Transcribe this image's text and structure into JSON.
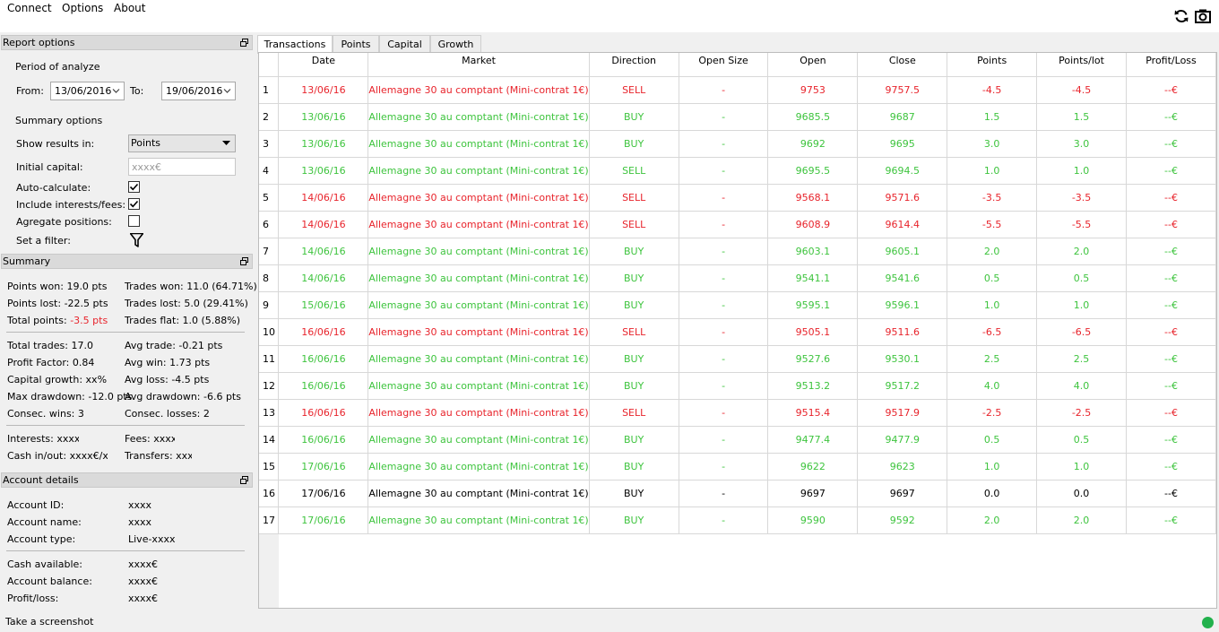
{
  "menu": [
    "Connect",
    "Options",
    "About"
  ],
  "toolbar": {
    "refresh_icon": "refresh-icon",
    "camera_icon": "camera-icon"
  },
  "report_options": {
    "title": "Report options",
    "period_label": "Period of analyze",
    "from_label": "From:",
    "from_value": "13/06/2016",
    "to_label": "To:",
    "to_value": "19/06/2016",
    "summary_options_label": "Summary options",
    "show_results_label": "Show results in:",
    "show_results_value": "Points",
    "initial_capital_label": "Initial capital:",
    "initial_capital_placeholder": "xxxx€",
    "auto_calculate_label": "Auto-calculate:",
    "auto_calculate": true,
    "include_interests_label": "Include interests/fees:",
    "include_interests": true,
    "aggregate_label": "Agregate positions:",
    "aggregate": false,
    "filter_label": "Set a filter:"
  },
  "summary": {
    "title": "Summary",
    "points_won": "Points won: 19.0 pts",
    "points_lost": "Points lost: -22.5 pts",
    "total_points_label": "Total points: ",
    "total_points_value": "-3.5 pts",
    "trades_won": "Trades won: 11.0 (64.71%)",
    "trades_lost": "Trades lost: 5.0 (29.41%)",
    "trades_flat": "Trades flat: 1.0 (5.88%)",
    "total_trades": "Total trades: 17.0",
    "profit_factor": "Profit Factor: 0.84",
    "capital_growth": "Capital growth: xx%",
    "max_drawdown": "Max drawdown: -12.0 pts",
    "consec_wins": "Consec. wins: 3",
    "avg_trade": "Avg trade: -0.21 pts",
    "avg_win": "Avg win: 1.73 pts",
    "avg_loss": "Avg loss: -4.5 pts",
    "avg_drawdown": "Avg drawdown: -6.6 pts",
    "consec_losses": "Consec. losses: 2",
    "interests": "Interests: xxxx’",
    "fees": "Fees: xxxx’",
    "cash_inout": "Cash in/out: xxxx€/xx:",
    "transfers": "Transfers: xxxx"
  },
  "account": {
    "title": "Account details",
    "id_label": "Account ID:",
    "id_value": "xxxx",
    "name_label": "Account name:",
    "name_value": "xxxx",
    "type_label": "Account type:",
    "type_value": "Live-xxxx",
    "cash_label": "Cash available:",
    "cash_value": "xxxx€",
    "balance_label": "Account balance:",
    "balance_value": "xxxx€",
    "pl_label": "Profit/loss:",
    "pl_value": "xxxx€"
  },
  "tabs": [
    "Transactions",
    "Points",
    "Capital",
    "Growth"
  ],
  "active_tab": "Transactions",
  "table": {
    "columns": [
      "Date",
      "Market",
      "Direction",
      "Open Size",
      "Open",
      "Close",
      "Points",
      "Points/lot",
      "Profit/Loss"
    ],
    "rows": [
      {
        "n": "1",
        "date": "13/06/16",
        "market": "Allemagne 30 au comptant (Mini-contrat 1€)",
        "direction": "SELL",
        "size": "-",
        "open": "9753",
        "close": "9757.5",
        "points": "-4.5",
        "points_lot": "-4.5",
        "pl": "--€",
        "status": "sell"
      },
      {
        "n": "2",
        "date": "13/06/16",
        "market": "Allemagne 30 au comptant (Mini-contrat 1€)",
        "direction": "BUY",
        "size": "-",
        "open": "9685.5",
        "close": "9687",
        "points": "1.5",
        "points_lot": "1.5",
        "pl": "--€",
        "status": "buy"
      },
      {
        "n": "3",
        "date": "13/06/16",
        "market": "Allemagne 30 au comptant (Mini-contrat 1€)",
        "direction": "BUY",
        "size": "-",
        "open": "9692",
        "close": "9695",
        "points": "3.0",
        "points_lot": "3.0",
        "pl": "--€",
        "status": "buy"
      },
      {
        "n": "4",
        "date": "13/06/16",
        "market": "Allemagne 30 au comptant (Mini-contrat 1€)",
        "direction": "SELL",
        "size": "-",
        "open": "9695.5",
        "close": "9694.5",
        "points": "1.0",
        "points_lot": "1.0",
        "pl": "--€",
        "status": "buy"
      },
      {
        "n": "5",
        "date": "14/06/16",
        "market": "Allemagne 30 au comptant (Mini-contrat 1€)",
        "direction": "SELL",
        "size": "-",
        "open": "9568.1",
        "close": "9571.6",
        "points": "-3.5",
        "points_lot": "-3.5",
        "pl": "--€",
        "status": "sell"
      },
      {
        "n": "6",
        "date": "14/06/16",
        "market": "Allemagne 30 au comptant (Mini-contrat 1€)",
        "direction": "SELL",
        "size": "-",
        "open": "9608.9",
        "close": "9614.4",
        "points": "-5.5",
        "points_lot": "-5.5",
        "pl": "--€",
        "status": "sell"
      },
      {
        "n": "7",
        "date": "14/06/16",
        "market": "Allemagne 30 au comptant (Mini-contrat 1€)",
        "direction": "BUY",
        "size": "-",
        "open": "9603.1",
        "close": "9605.1",
        "points": "2.0",
        "points_lot": "2.0",
        "pl": "--€",
        "status": "buy"
      },
      {
        "n": "8",
        "date": "14/06/16",
        "market": "Allemagne 30 au comptant (Mini-contrat 1€)",
        "direction": "BUY",
        "size": "-",
        "open": "9541.1",
        "close": "9541.6",
        "points": "0.5",
        "points_lot": "0.5",
        "pl": "--€",
        "status": "buy"
      },
      {
        "n": "9",
        "date": "15/06/16",
        "market": "Allemagne 30 au comptant (Mini-contrat 1€)",
        "direction": "BUY",
        "size": "-",
        "open": "9595.1",
        "close": "9596.1",
        "points": "1.0",
        "points_lot": "1.0",
        "pl": "--€",
        "status": "buy"
      },
      {
        "n": "10",
        "date": "16/06/16",
        "market": "Allemagne 30 au comptant (Mini-contrat 1€)",
        "direction": "SELL",
        "size": "-",
        "open": "9505.1",
        "close": "9511.6",
        "points": "-6.5",
        "points_lot": "-6.5",
        "pl": "--€",
        "status": "sell"
      },
      {
        "n": "11",
        "date": "16/06/16",
        "market": "Allemagne 30 au comptant (Mini-contrat 1€)",
        "direction": "BUY",
        "size": "-",
        "open": "9527.6",
        "close": "9530.1",
        "points": "2.5",
        "points_lot": "2.5",
        "pl": "--€",
        "status": "buy"
      },
      {
        "n": "12",
        "date": "16/06/16",
        "market": "Allemagne 30 au comptant (Mini-contrat 1€)",
        "direction": "BUY",
        "size": "-",
        "open": "9513.2",
        "close": "9517.2",
        "points": "4.0",
        "points_lot": "4.0",
        "pl": "--€",
        "status": "buy"
      },
      {
        "n": "13",
        "date": "16/06/16",
        "market": "Allemagne 30 au comptant (Mini-contrat 1€)",
        "direction": "SELL",
        "size": "-",
        "open": "9515.4",
        "close": "9517.9",
        "points": "-2.5",
        "points_lot": "-2.5",
        "pl": "--€",
        "status": "sell"
      },
      {
        "n": "14",
        "date": "16/06/16",
        "market": "Allemagne 30 au comptant (Mini-contrat 1€)",
        "direction": "BUY",
        "size": "-",
        "open": "9477.4",
        "close": "9477.9",
        "points": "0.5",
        "points_lot": "0.5",
        "pl": "--€",
        "status": "buy"
      },
      {
        "n": "15",
        "date": "17/06/16",
        "market": "Allemagne 30 au comptant (Mini-contrat 1€)",
        "direction": "BUY",
        "size": "-",
        "open": "9622",
        "close": "9623",
        "points": "1.0",
        "points_lot": "1.0",
        "pl": "--€",
        "status": "buy"
      },
      {
        "n": "16",
        "date": "17/06/16",
        "market": "Allemagne 30 au comptant (Mini-contrat 1€)",
        "direction": "BUY",
        "size": "-",
        "open": "9697",
        "close": "9697",
        "points": "0.0",
        "points_lot": "0.0",
        "pl": "--€",
        "status": "flat"
      },
      {
        "n": "17",
        "date": "17/06/16",
        "market": "Allemagne 30 au comptant (Mini-contrat 1€)",
        "direction": "BUY",
        "size": "-",
        "open": "9590",
        "close": "9592",
        "points": "2.0",
        "points_lot": "2.0",
        "pl": "--€",
        "status": "buy"
      }
    ]
  },
  "status": {
    "text": "Take a screenshot",
    "connection_icon": "connection-status-icon",
    "connection_color": "#22b14c"
  },
  "colors": {
    "gain": "#3ec43e",
    "loss": "#e8242c",
    "neutral": "#000000"
  }
}
